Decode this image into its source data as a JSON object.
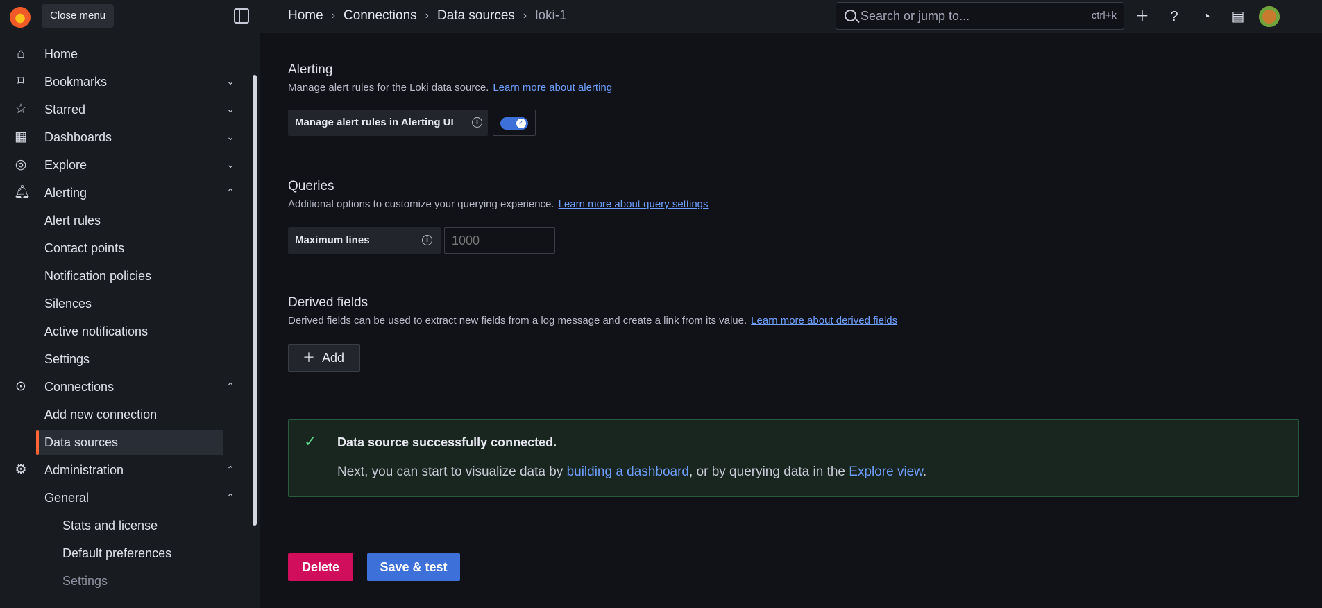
{
  "header": {
    "tooltip": "Close menu",
    "breadcrumbs": [
      "Home",
      "Connections",
      "Data sources",
      "loki-1"
    ],
    "search_placeholder": "Search or jump to...",
    "shortcut": "ctrl+k",
    "actions": [
      "plus-icon",
      "help-icon",
      "rss-icon",
      "dock-icon",
      "avatar"
    ]
  },
  "sidebar": {
    "items": [
      {
        "label": "Home",
        "icon": "home-icon"
      },
      {
        "label": "Bookmarks",
        "icon": "bookmark-icon"
      },
      {
        "label": "Starred",
        "icon": "star-icon"
      },
      {
        "label": "Dashboards",
        "icon": "grid-icon"
      },
      {
        "label": "Explore",
        "icon": "compass-icon"
      },
      {
        "label": "Alerting",
        "icon": "bell-icon"
      },
      {
        "label": "Alert rules"
      },
      {
        "label": "Contact points"
      },
      {
        "label": "Notification policies"
      },
      {
        "label": "Silences"
      },
      {
        "label": "Active notifications"
      },
      {
        "label": "Settings"
      },
      {
        "label": "Connections",
        "icon": "connections-icon"
      },
      {
        "label": "Add new connection"
      },
      {
        "label": "Data sources"
      },
      {
        "label": "Administration",
        "icon": "gear-icon"
      },
      {
        "label": "General"
      },
      {
        "label": "Stats and license"
      },
      {
        "label": "Default preferences"
      },
      {
        "label": "Settings"
      }
    ]
  },
  "main": {
    "alerting": {
      "title": "Alerting",
      "description": "Manage alert rules for the Loki data source.",
      "link": "Learn more about alerting",
      "field_label": "Manage alert rules in Alerting UI",
      "enabled": true
    },
    "queries": {
      "title": "Queries",
      "description": "Additional options to customize your querying experience.",
      "link": "Learn more about query settings",
      "field_label": "Maximum lines",
      "placeholder": "1000"
    },
    "derived": {
      "title": "Derived fields",
      "description": "Derived fields can be used to extract new fields from a log message and create a link from its value.",
      "link": "Learn more about derived fields",
      "add_label": "Add"
    },
    "alert": {
      "title": "Data source successfully connected.",
      "body_prefix": "Next, you can start to visualize data by ",
      "link_dashboard": "building a dashboard",
      "body_middle": ", or by querying data in the ",
      "link_explore": "Explore view",
      "body_suffix": "."
    },
    "buttons": {
      "delete": "Delete",
      "save": "Save & test"
    }
  }
}
